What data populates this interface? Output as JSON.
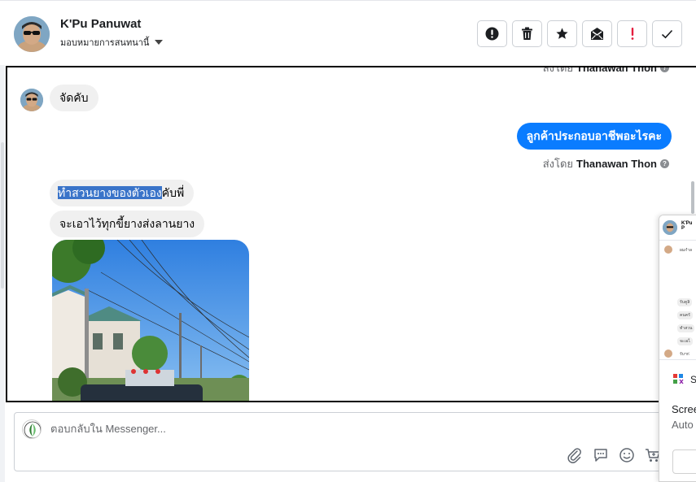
{
  "header": {
    "contact_name": "K'Pu Panuwat",
    "assign_label": "มอบหมายการสนทนานี้",
    "toolbar": [
      {
        "name": "mark-spam-button",
        "icon": "alert-circle-icon"
      },
      {
        "name": "delete-button",
        "icon": "trash-icon"
      },
      {
        "name": "star-button",
        "icon": "star-icon"
      },
      {
        "name": "mark-unread-button",
        "icon": "envelope-icon"
      },
      {
        "name": "follow-up-button",
        "icon": "exclamation-icon"
      },
      {
        "name": "mark-done-button",
        "icon": "check-icon"
      }
    ]
  },
  "conversation": {
    "top_sent_by_prefix": "ส่งโดย",
    "top_sent_by_name": "Thanawan Thon",
    "msg1": "จัดคับ",
    "msg2": "ลูกค้าประกอบอาชีพอะไรคะ",
    "sent_by_prefix": "ส่งโดย",
    "sent_by_name": "Thanawan Thon",
    "msg3_highlighted": "ทำสวนยางของตัวเอง",
    "msg3_rest": "คับพี่",
    "msg4": "จะเอาไว้ทุกขี้ยางส่งลานยาง"
  },
  "composer": {
    "placeholder": "ตอบกลับใน Messenger..."
  },
  "side_panel": {
    "mini_name": "K'Pu P",
    "mini_rows": [
      "ผมกำล",
      "รับคูลิ",
      "คนครั",
      "ทำสวน",
      "จะเอไ",
      "รับฯก่"
    ],
    "app_label": "S",
    "title": "Scree",
    "subtitle": "Auto"
  },
  "colors": {
    "outgoing_bubble": "#0a7cff",
    "incoming_bubble": "#f0f0f0",
    "highlight": "#3a74c9",
    "follow_up_red": "#e41e3f"
  }
}
